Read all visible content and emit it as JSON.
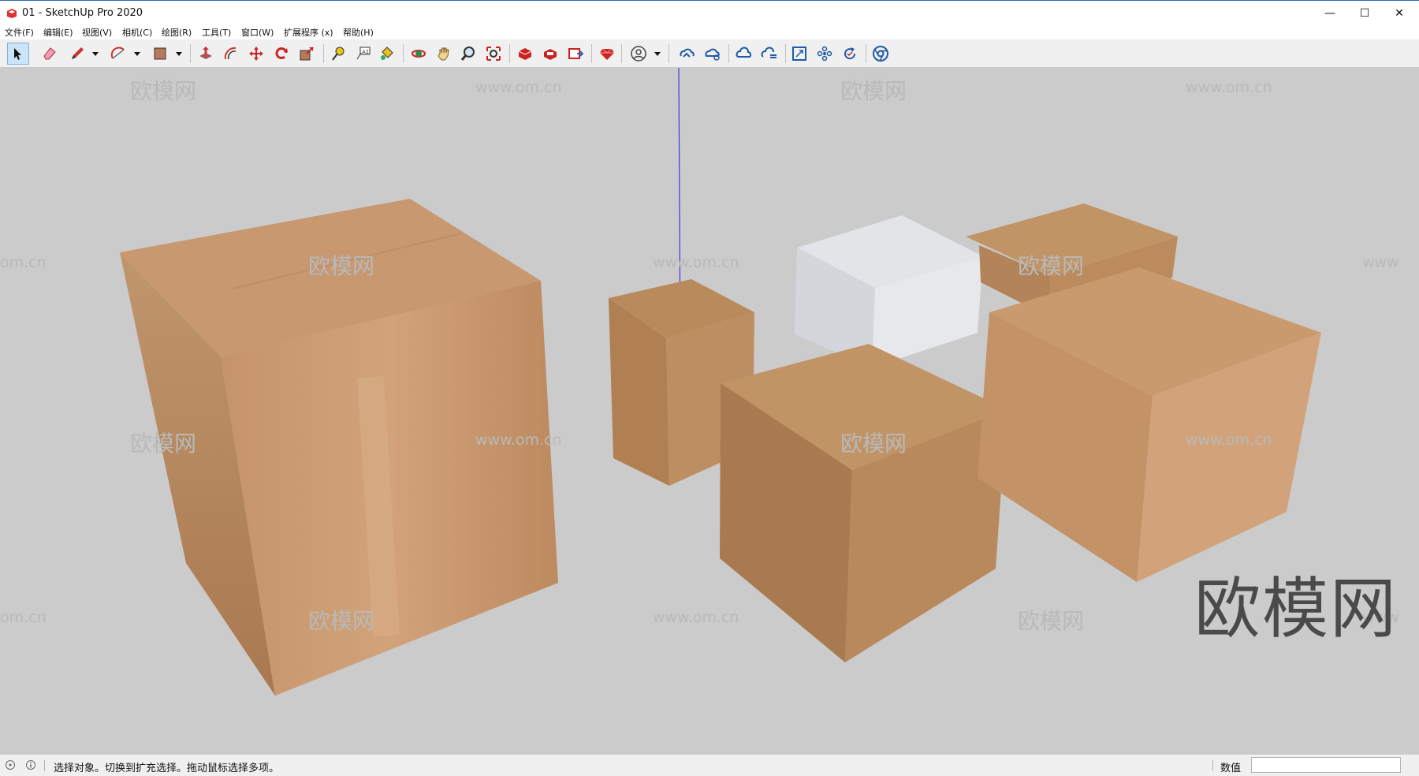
{
  "window": {
    "title": "01 - SketchUp Pro 2020",
    "minimize": "—",
    "maximize": "☐",
    "close": "✕"
  },
  "menu": [
    "文件(F)",
    "编辑(E)",
    "视图(V)",
    "相机(C)",
    "绘图(R)",
    "工具(T)",
    "窗口(W)",
    "扩展程序 (x)",
    "帮助(H)"
  ],
  "toolbar": {
    "tools": [
      "select-icon",
      "eraser-icon",
      "pencil-icon",
      "arc-icon",
      "rectangle-icon",
      "push-pull-icon",
      "offset-icon",
      "move-icon",
      "rotate-icon",
      "scale-icon",
      "tape-measure-icon",
      "text-icon",
      "paint-bucket-icon",
      "orbit-icon",
      "pan-icon",
      "zoom-icon",
      "zoom-extents-icon",
      "3d-warehouse-icon",
      "extension-warehouse-icon",
      "layout-icon",
      "ruby-console-icon",
      "account-icon",
      "trimble-connect-icon",
      "trimble-share-icon",
      "cloud-icon",
      "cloud-sync-icon",
      "fit-view-icon",
      "components-icon",
      "refresh-icon",
      "chrome-icon"
    ]
  },
  "viewport": {
    "watermark_cn": "欧模网",
    "watermark_url": "www.om.cn",
    "watermark_edge": "om.cn",
    "watermark_edge_right": "www",
    "watermark_big": "欧模网"
  },
  "status": {
    "text": "选择对象。切换到扩充选择。拖动鼠标选择多项。",
    "vcb_label": "数值",
    "vcb_value": ""
  },
  "colors": {
    "viewport_bg": "#cbcbcb",
    "box_top": "#c19466",
    "box_side": "#b08055",
    "white_box": "#e6e8ec",
    "axis_blue": "#3a3adf",
    "active_tool": "#cce4f7"
  }
}
